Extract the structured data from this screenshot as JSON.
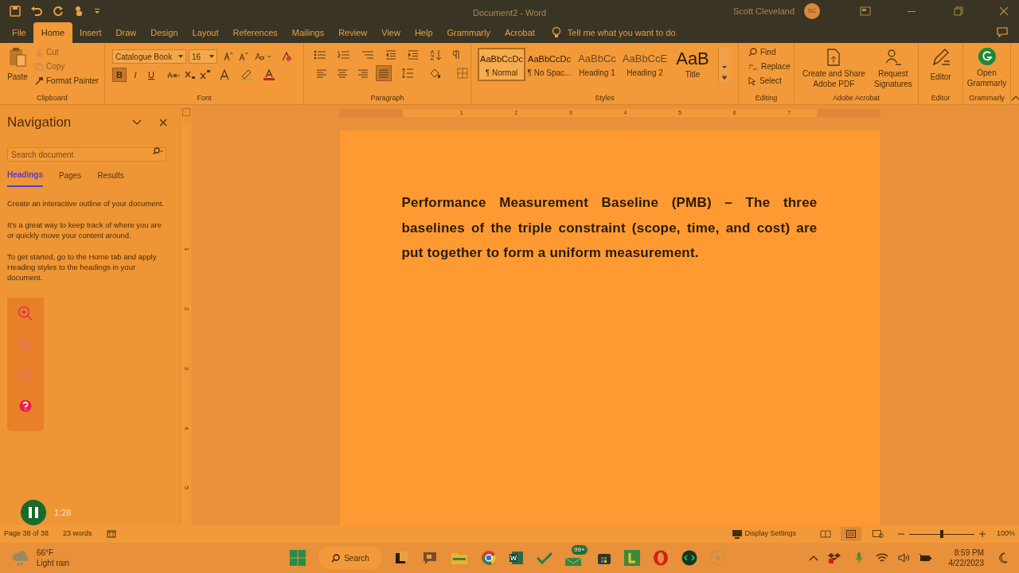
{
  "window": {
    "title": "Document2  -  Word",
    "user": "Scott Cleveland",
    "initials": "SC"
  },
  "tabs": [
    {
      "label": "File",
      "selected": false
    },
    {
      "label": "Home",
      "selected": true
    },
    {
      "label": "Insert",
      "selected": false
    },
    {
      "label": "Draw",
      "selected": false
    },
    {
      "label": "Design",
      "selected": false
    },
    {
      "label": "Layout",
      "selected": false
    },
    {
      "label": "References",
      "selected": false
    },
    {
      "label": "Mailings",
      "selected": false
    },
    {
      "label": "Review",
      "selected": false
    },
    {
      "label": "View",
      "selected": false
    },
    {
      "label": "Help",
      "selected": false
    },
    {
      "label": "Grammarly",
      "selected": false
    },
    {
      "label": "Acrobat",
      "selected": false
    }
  ],
  "tell_me": "Tell me what you want to do",
  "clipboard": {
    "paste": "Paste",
    "cut": "Cut",
    "copy": "Copy",
    "format_painter": "Format Painter",
    "label": "Clipboard"
  },
  "font": {
    "name": "Catalogue Book",
    "size": "16",
    "label": "Font",
    "format_buttons": [
      {
        "label": "B",
        "selected": true
      },
      {
        "label": "I",
        "selected": false
      },
      {
        "label": "U",
        "selected": false
      }
    ]
  },
  "paragraph": {
    "label": "Paragraph",
    "alignments": [
      {
        "selected": false
      },
      {
        "selected": false
      },
      {
        "selected": false
      },
      {
        "selected": true
      }
    ]
  },
  "styles": {
    "label": "Styles",
    "items": [
      {
        "preview": "AaBbCcDc",
        "name": "¶ Normal",
        "selected": true
      },
      {
        "preview": "AaBbCcDc",
        "name": "¶ No Spac...",
        "selected": false
      },
      {
        "preview": "AaBbCc",
        "name": "Heading 1",
        "selected": false
      },
      {
        "preview": "AaBbCcE",
        "name": "Heading 2",
        "selected": false
      },
      {
        "preview": "AaB",
        "name": "Title",
        "selected": false
      }
    ]
  },
  "editing": {
    "label": "Editing",
    "find": "Find",
    "replace": "Replace",
    "select": "Select"
  },
  "acrobat": {
    "label": "Adobe Acrobat",
    "create": "Create and Share Adobe PDF",
    "request": "Request Signatures"
  },
  "editor": {
    "button": "Editor",
    "label": "Editor"
  },
  "grammarly": {
    "button": "Open Grammarly",
    "label": "Grammarly"
  },
  "ruler": {
    "labels": [
      "1",
      "2",
      "3",
      "4",
      "5",
      "6",
      "7"
    ]
  },
  "vertical_ruler": {
    "labels": [
      "1",
      "2",
      "3",
      "4",
      "5"
    ]
  },
  "navigation": {
    "title": "Navigation",
    "placeholder": "Search document",
    "tabs": [
      {
        "label": "Headings",
        "selected": true
      },
      {
        "label": "Pages",
        "selected": false
      },
      {
        "label": "Results",
        "selected": false
      }
    ],
    "paragraphs": [
      "Create an interactive outline of your document.",
      "It's a great way to keep track of where you are or quickly move your content around.",
      "To get started, go to the Home tab and apply Heading styles to the headings in your document."
    ]
  },
  "document": {
    "paragraph": "Performance Measurement Baseline (PMB) – The three baselines of the triple constraint (scope, time, and cost) are put together to form a uniform measurement."
  },
  "recorder": {
    "time": "1:28"
  },
  "status_bar": {
    "page": "Page 38 of 38",
    "words": "23 words",
    "display_settings": "Display Settings",
    "zoom": "100%",
    "zoom_level": {
      "level": 0.5
    }
  },
  "taskbar": {
    "temperature": "66°F",
    "condition": "Light rain",
    "search": "Search",
    "badge": "99+",
    "time": "8:59 PM",
    "date": "4/22/2023"
  }
}
